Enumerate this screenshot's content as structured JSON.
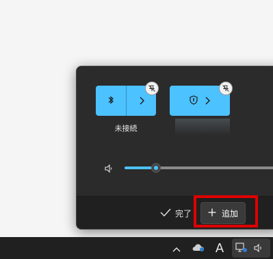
{
  "quick_settings": {
    "bluetooth_tile": {
      "status_label": "未接続"
    },
    "volume": {
      "level_fraction": 0.2
    }
  },
  "footer": {
    "done_label": "完了",
    "add_label": "追加"
  },
  "taskbar": {
    "ime_mode": "A"
  },
  "colors": {
    "accent": "#4cc2ff",
    "panel_bg": "#2b2b2b",
    "footer_bg": "#202020",
    "taskbar_bg": "#202020",
    "highlight": "#e00000"
  }
}
